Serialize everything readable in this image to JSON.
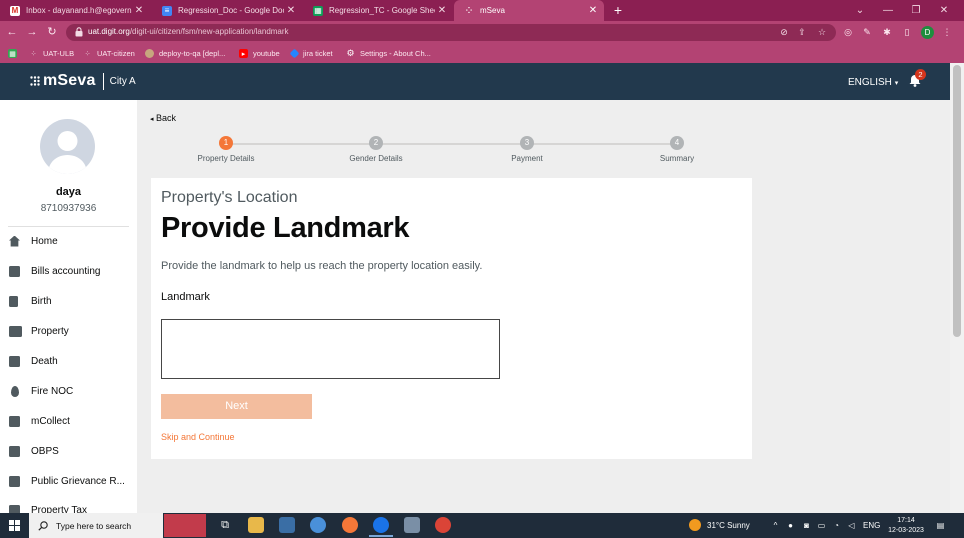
{
  "browser": {
    "tabs": [
      {
        "title": "Inbox - dayanand.h@egovernme",
        "favicon": "gmail-icon",
        "active": false
      },
      {
        "title": "Regression_Doc - Google Docs",
        "favicon": "google-docs-icon",
        "active": false
      },
      {
        "title": "Regression_TC - Google Sheets",
        "favicon": "google-sheets-icon",
        "active": false
      },
      {
        "title": "mSeva",
        "favicon": "mseva-icon",
        "active": true
      }
    ],
    "url_host": "uat.digit.org",
    "url_path": "/digit-ui/citizen/fsm/new-application/landmark",
    "profile_initial": "D",
    "bookmarks": [
      {
        "label": "",
        "icon": "apps-grid-icon"
      },
      {
        "label": "UAT-ULB",
        "icon": "bookmark-icon"
      },
      {
        "label": "UAT-citizen",
        "icon": "bookmark-icon"
      },
      {
        "label": "deploy-to-qa [depl...",
        "icon": "jenkins-icon"
      },
      {
        "label": "youtube",
        "icon": "youtube-icon"
      },
      {
        "label": "jira ticket",
        "icon": "jira-icon"
      },
      {
        "label": "Settings - About Ch...",
        "icon": "settings-gear-icon"
      }
    ]
  },
  "header": {
    "brand": "mSeva",
    "city": "City A",
    "language": "ENGLISH",
    "notification_count": "2"
  },
  "sidebar": {
    "user_name": "daya",
    "user_phone": "8710937936",
    "items": [
      {
        "label": "Home",
        "icon": "home-icon"
      },
      {
        "label": "Bills accounting",
        "icon": "bills-icon"
      },
      {
        "label": "Birth",
        "icon": "birth-icon"
      },
      {
        "label": "Property",
        "icon": "property-icon"
      },
      {
        "label": "Death",
        "icon": "death-icon"
      },
      {
        "label": "Fire NOC",
        "icon": "fire-icon"
      },
      {
        "label": "mCollect",
        "icon": "collect-icon"
      },
      {
        "label": "OBPS",
        "icon": "obps-icon"
      },
      {
        "label": "Public Grievance R...",
        "icon": "grievance-icon"
      },
      {
        "label": "Property Tax",
        "icon": "property-tax-icon"
      }
    ]
  },
  "main": {
    "back_label": "Back",
    "steps": [
      {
        "number": "1",
        "label": "Property Details",
        "active": true
      },
      {
        "number": "2",
        "label": "Gender Details",
        "active": false
      },
      {
        "number": "3",
        "label": "Payment",
        "active": false
      },
      {
        "number": "4",
        "label": "Summary",
        "active": false
      }
    ],
    "subtitle": "Property's Location",
    "title": "Provide Landmark",
    "description": "Provide the landmark to help us reach the property location easily.",
    "field_label": "Landmark",
    "field_value": "",
    "next_label": "Next",
    "skip_label": "Skip and Continue"
  },
  "taskbar": {
    "search_placeholder": "Type here to search",
    "weather": "31°C  Sunny",
    "lang": "ENG",
    "time": "17:14",
    "date": "12-03-2023"
  },
  "colors": {
    "accent": "#f47738",
    "header_bg": "#22394d",
    "browser_frame": "#8b1f52",
    "disabled_button": "#f3bd9e"
  }
}
